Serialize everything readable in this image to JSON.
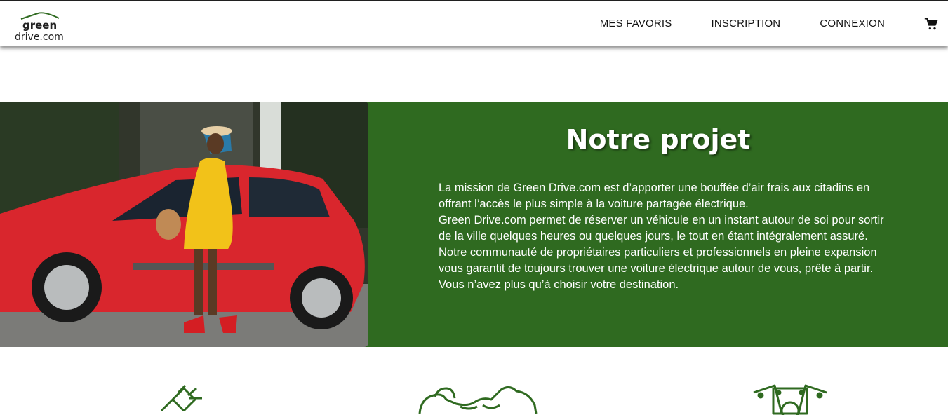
{
  "brand": {
    "line1": "green",
    "line2": "drive.com",
    "accent": "#2f6a20"
  },
  "nav": {
    "favorites": "MES FAVORIS",
    "signup": "INSCRIPTION",
    "login": "CONNEXION",
    "cart_icon": "shopping-cart-icon"
  },
  "hero": {
    "title": "Notre projet",
    "paragraphs": [
      "La mission de Green Drive.com est d’apporter une bouffée d’air frais aux citadins en offrant l’accès le plus simple à la voiture partagée électrique.",
      "Green Drive.com permet de réserver un véhicule en un instant autour de soi pour sortir de la ville quelques heures ou quelques jours, le tout en étant intégralement assuré.",
      "Notre communauté de propriétaires particuliers et professionnels en pleine expansion vous garantit de toujours trouver une voiture électrique autour de vous, prête à partir. Vous n’avez plus qu’à choisir votre destination."
    ]
  },
  "features": {
    "icons": [
      "plug-icon",
      "handshake-icon",
      "money-icon"
    ]
  }
}
